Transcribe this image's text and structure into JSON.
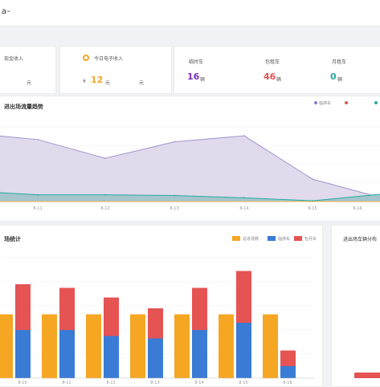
{
  "header": {
    "title": "a"
  },
  "kpi": {
    "cash": {
      "label": "现金收入",
      "unit": "元"
    },
    "today": {
      "label": "今日电子收入",
      "value": "12",
      "unit": "元",
      "prefix": "¥",
      "right_unit": "元"
    },
    "counts": [
      {
        "label": "临时车",
        "value": "16",
        "unit": "辆",
        "color": "#7b2fbf"
      },
      {
        "label": "包租车",
        "value": "46",
        "unit": "辆",
        "color": "#e55353"
      },
      {
        "label": "月租车",
        "value": "0",
        "unit": "辆",
        "color": "#2aa9a0"
      }
    ]
  },
  "trend": {
    "title": "进出场流量趋势",
    "legend": [
      {
        "name": "临停车",
        "color": "#8e7cc3"
      },
      {
        "name": "",
        "color": "#e55353"
      },
      {
        "name": "",
        "color": "#2aa9a0"
      }
    ]
  },
  "bars": {
    "title": "场统计",
    "legend": [
      {
        "name": "总进场数",
        "color": "#f5a623"
      },
      {
        "name": "临停车",
        "color": "#3a7bd5"
      },
      {
        "name": "包月车",
        "color": "#e55353"
      }
    ]
  },
  "side": {
    "title": "进出场车辆分布"
  },
  "colors": {
    "purple_fill": "#ddd6ea",
    "teal_fill": "#9fc3c9",
    "orange": "#f5a623",
    "blue": "#3a7bd5",
    "red": "#e55353"
  },
  "chart_data": [
    {
      "type": "area",
      "title": "进出场流量趋势",
      "categories": [
        "8-10",
        "8-11",
        "8-12",
        "8-13",
        "8-14",
        "8-15",
        "8-16"
      ],
      "series": [
        {
          "name": "临停车",
          "values": [
            88,
            83,
            58,
            80,
            88,
            30,
            5
          ]
        },
        {
          "name": "",
          "values": [
            12,
            9,
            9,
            8,
            5,
            1,
            10
          ]
        }
      ],
      "ylim": [
        0,
        100
      ]
    },
    {
      "type": "bar",
      "title": "场统计",
      "categories": [
        "8-10",
        "8-11",
        "8-12",
        "8-13",
        "8-14",
        "8-15",
        "8-16"
      ],
      "series": [
        {
          "name": "总进场数",
          "values": [
            53,
            53,
            53,
            53,
            53,
            53,
            53
          ]
        },
        {
          "name": "临停车",
          "values": [
            40,
            40,
            35,
            33,
            40,
            46,
            10
          ]
        },
        {
          "name": "包月车",
          "values": [
            38,
            35,
            32,
            25,
            35,
            43,
            13
          ]
        }
      ],
      "ylim": [
        0,
        100
      ]
    }
  ]
}
